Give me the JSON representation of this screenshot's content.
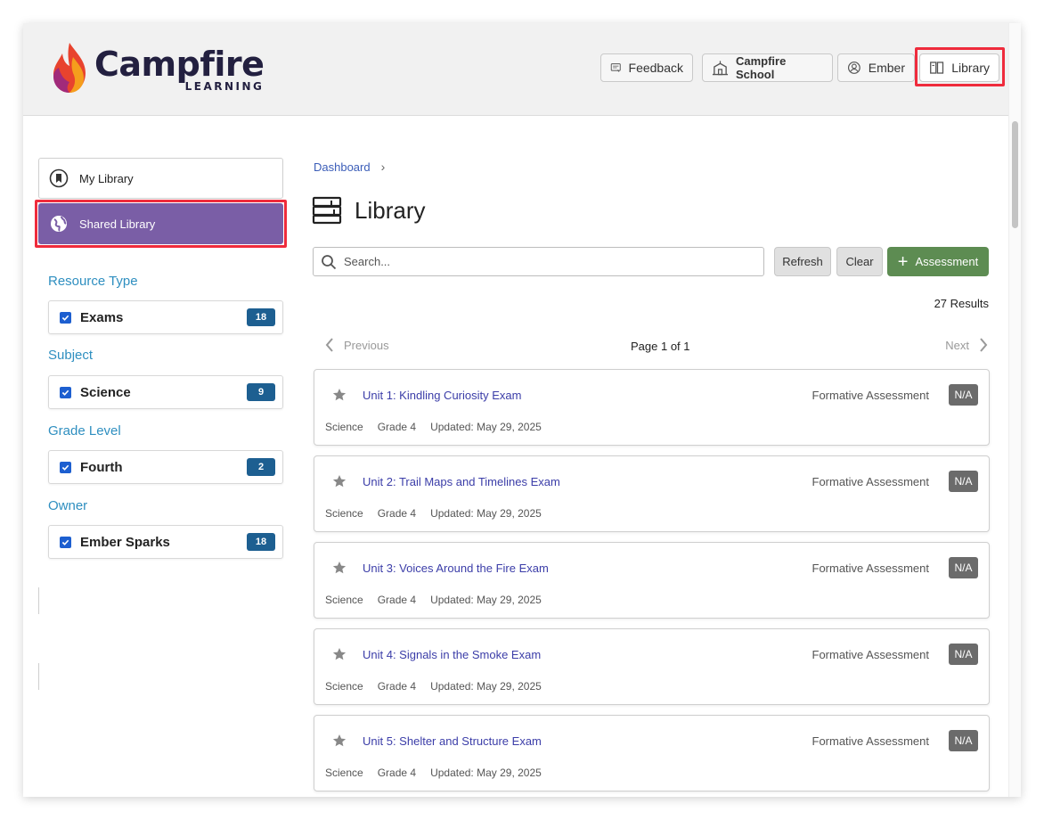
{
  "header": {
    "logo_word": "Campfire",
    "logo_sub": "LEARNING",
    "buttons": {
      "feedback": "Feedback",
      "school": "Campfire School",
      "user": "Ember",
      "library": "Library"
    }
  },
  "sidebar": {
    "my_library": "My Library",
    "shared_library": "Shared Library",
    "facets": [
      {
        "title": "Resource Type",
        "label": "Exams",
        "count": "18"
      },
      {
        "title": "Subject",
        "label": "Science",
        "count": "9"
      },
      {
        "title": "Grade Level",
        "label": "Fourth",
        "count": "2"
      },
      {
        "title": "Owner",
        "label": "Ember Sparks",
        "count": "18"
      }
    ]
  },
  "main": {
    "breadcrumb": "Dashboard",
    "title": "Library",
    "search_placeholder": "Search...",
    "refresh": "Refresh",
    "clear": "Clear",
    "assessment": "Assessment",
    "results": "27 Results",
    "pager": {
      "previous": "Previous",
      "page": "Page 1 of 1",
      "next": "Next"
    },
    "cards": [
      {
        "title": "Unit 1: Kindling Curiosity Exam",
        "kind": "Formative Assessment",
        "badge": "N/A",
        "subject": "Science",
        "grade": "Grade 4",
        "updated": "Updated: May 29, 2025"
      },
      {
        "title": "Unit 2: Trail Maps and Timelines Exam",
        "kind": "Formative Assessment",
        "badge": "N/A",
        "subject": "Science",
        "grade": "Grade 4",
        "updated": "Updated: May 29, 2025"
      },
      {
        "title": "Unit 3: Voices Around the Fire Exam",
        "kind": "Formative Assessment",
        "badge": "N/A",
        "subject": "Science",
        "grade": "Grade 4",
        "updated": "Updated: May 29, 2025"
      },
      {
        "title": "Unit 4: Signals in the Smoke Exam",
        "kind": "Formative Assessment",
        "badge": "N/A",
        "subject": "Science",
        "grade": "Grade 4",
        "updated": "Updated: May 29, 2025"
      },
      {
        "title": "Unit 5: Shelter and Structure Exam",
        "kind": "Formative Assessment",
        "badge": "N/A",
        "subject": "Science",
        "grade": "Grade 4",
        "updated": "Updated: May 29, 2025"
      }
    ]
  },
  "colors": {
    "accent_purple": "#7a5ea6",
    "highlight_red": "#ef2b3c",
    "green": "#5d8c52",
    "badge_blue": "#1d5f91"
  }
}
